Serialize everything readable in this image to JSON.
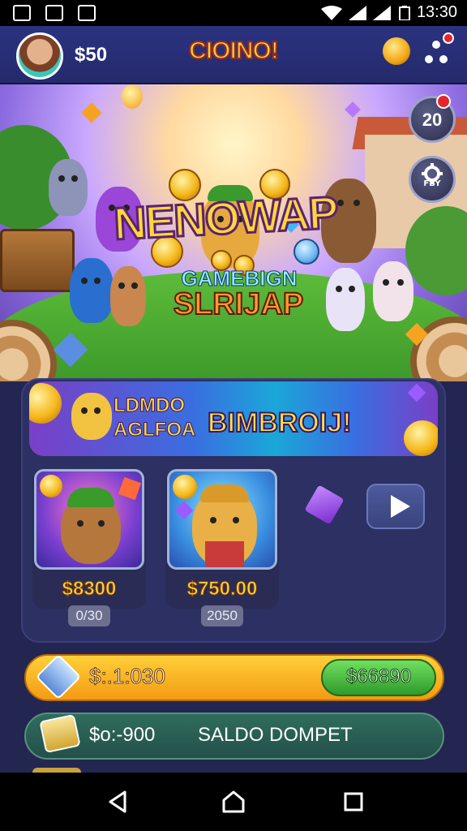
{
  "status_bar": {
    "time": "13:30"
  },
  "header": {
    "balance": "$50",
    "logo_text": "CIOINO!"
  },
  "hero": {
    "title": "NENOWAP",
    "subtitle_line1": "GAMEBIGN",
    "subtitle_line2": "SLRIJAP",
    "level_badge": "20",
    "settings_label": "FBY"
  },
  "promo": {
    "line1": "LDMDO",
    "line2": "AGLFOA",
    "headline": "BIMBROIJ!"
  },
  "cards": [
    {
      "price": "$8300",
      "badge": "0/30"
    },
    {
      "price": "$750.00",
      "badge": "2050"
    }
  ],
  "balance_bar": {
    "amount": "$:.1:030",
    "button_label": "$66890"
  },
  "wallet_bar": {
    "amount": "$o:-900",
    "label": "SALDO DOMPET"
  },
  "colors": {
    "header_bg": "#2b3380",
    "gold": "#f5b81a",
    "green": "#3fb834",
    "panel": "#2c3063"
  }
}
